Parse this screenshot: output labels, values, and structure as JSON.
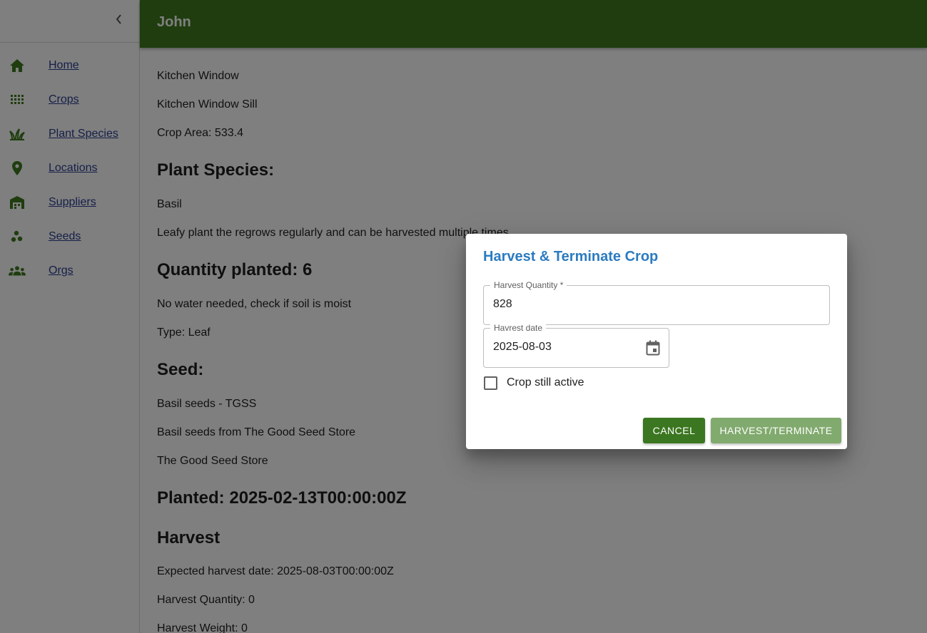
{
  "header": {
    "title": "John"
  },
  "sidebar": {
    "collapse_icon": "chevron-left-icon",
    "items": [
      {
        "label": "Home",
        "icon": "home-icon"
      },
      {
        "label": "Crops",
        "icon": "grid-icon"
      },
      {
        "label": "Plant Species",
        "icon": "grass-icon"
      },
      {
        "label": "Locations",
        "icon": "location-pin-icon"
      },
      {
        "label": "Suppliers",
        "icon": "warehouse-icon"
      },
      {
        "label": "Seeds",
        "icon": "seeds-icon"
      },
      {
        "label": "Orgs",
        "icon": "groups-icon"
      }
    ]
  },
  "content": {
    "location_name": "Kitchen Window",
    "location_desc": "Kitchen Window Sill",
    "crop_area": "Crop Area: 533.4",
    "plant_species_heading": "Plant Species:",
    "species_name": "Basil",
    "species_desc": "Leafy plant the regrows regularly and can be harvested multiple times",
    "quantity_heading": "Quantity planted: 6",
    "water_note": "No water needed, check if soil is moist",
    "type": "Type: Leaf",
    "seed_heading": "Seed:",
    "seed_name": "Basil seeds - TGSS",
    "seed_desc": "Basil seeds from The Good Seed Store",
    "seed_supplier": "The Good Seed Store",
    "planted_heading": "Planted: 2025-02-13T00:00:00Z",
    "harvest_heading": "Harvest",
    "expected_harvest": "Expected harvest date: 2025-08-03T00:00:00Z",
    "harvest_quantity": "Harvest Quantity: 0",
    "harvest_weight": "Harvest Weight: 0"
  },
  "dialog": {
    "title": "Harvest & Terminate Crop",
    "quantity_label": "Harvest Quantity *",
    "quantity_value": "828",
    "date_label": "Havrest date",
    "date_value": "2025-08-03",
    "checkbox_label": "Crop still active",
    "checkbox_checked": false,
    "cancel_label": "CANCEL",
    "submit_label": "HARVEST/TERMINATE"
  },
  "colors": {
    "brand_green": "#3f7a1e",
    "dialog_title": "#2b7bc0",
    "submit_button": "#81aa6e",
    "link": "#2a3f8f"
  }
}
